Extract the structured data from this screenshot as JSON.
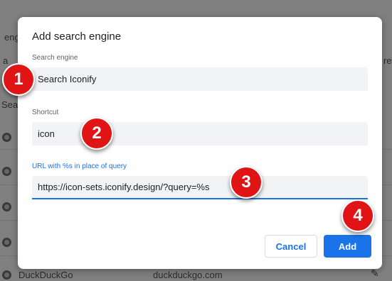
{
  "background": {
    "texts": [
      {
        "id": "eng",
        "text": "eng"
      },
      {
        "id": "a",
        "text": "a"
      },
      {
        "id": "sea",
        "text": "Sea"
      },
      {
        "id": "ref",
        "text": "ref"
      },
      {
        "id": "ddg-name",
        "text": "DuckDuckGo"
      },
      {
        "id": "ddg-url",
        "text": "duckduckgo.com"
      }
    ]
  },
  "dialog": {
    "title": "Add search engine",
    "fields": {
      "search_engine": {
        "label": "Search engine",
        "value": "Search Iconify"
      },
      "shortcut": {
        "label": "Shortcut",
        "value": "icon"
      },
      "url": {
        "label": "URL with %s in place of query",
        "value": "https://icon-sets.iconify.design/?query=%s"
      }
    },
    "buttons": {
      "cancel": "Cancel",
      "add": "Add"
    }
  },
  "badges": [
    "1",
    "2",
    "3",
    "4"
  ],
  "colors": {
    "accent": "#1a73e8",
    "badge": "#e01414",
    "field_bg": "#f1f3f4"
  }
}
